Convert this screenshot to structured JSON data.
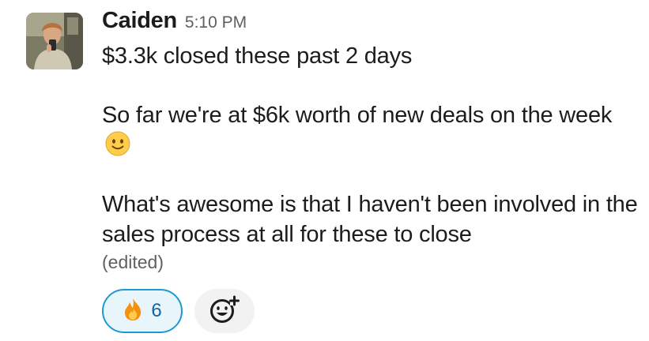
{
  "message": {
    "author": "Caiden",
    "timestamp": "5:10 PM",
    "paragraphs": [
      "$3.3k closed these past 2 days",
      "So far we're at $6k worth of new deals on the week",
      "What's awesome is that I haven't been involved in the sales process at all for these to close"
    ],
    "emoji": "slightly-smiling-face-icon",
    "edited_label": "(edited)"
  },
  "reactions": [
    {
      "emoji": "fire-icon",
      "count": "6"
    }
  ],
  "add_reaction": {
    "icon": "add-emoji-icon"
  },
  "colors": {
    "reaction_border": "#1d9bd1",
    "reaction_bg": "#e8f5fa",
    "reaction_count": "#1264a3",
    "text": "#1d1c1d",
    "muted": "#616061"
  }
}
